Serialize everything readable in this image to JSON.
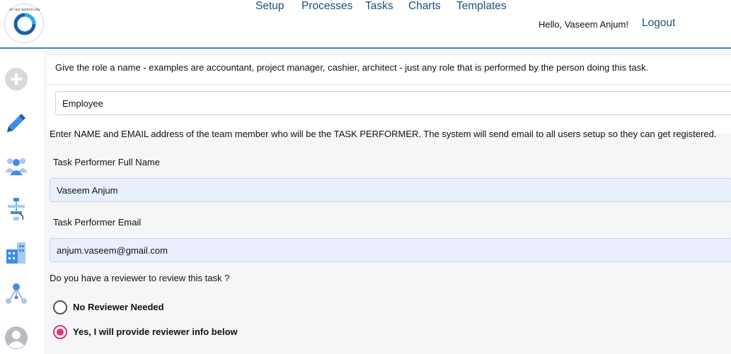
{
  "header": {
    "logo_icon": "my-biz-workflow-logo",
    "logo_text": "MY BIZ WORKFLOW",
    "nav": [
      {
        "label": "Setup"
      },
      {
        "label": "Processes"
      },
      {
        "label": "Tasks"
      },
      {
        "label": "Charts"
      },
      {
        "label": "Templates"
      }
    ],
    "greeting": "Hello,  Vaseem Anjum!",
    "logout": "Logout"
  },
  "sidebar": {
    "items": [
      {
        "icon": "add-icon"
      },
      {
        "icon": "edit-pencil-icon"
      },
      {
        "icon": "team-icon"
      },
      {
        "icon": "flowchart-icon"
      },
      {
        "icon": "buildings-icon"
      },
      {
        "icon": "network-icon"
      },
      {
        "icon": "user-avatar-icon"
      }
    ]
  },
  "form": {
    "role_hint": "Give the role a name - examples are accountant, project manager, cashier, architect - just any role that is performed by the person doing this task.",
    "role_value": "Employee",
    "instruction": "Enter NAME and EMAIL address of the team member who will be the TASK PERFORMER. The system will send email to all users setup so they can get registered.",
    "name_label": "Task Performer Full Name",
    "name_value": "Vaseem Anjum",
    "email_label": "Task Performer Email",
    "email_value": "anjum.vaseem@gmail.com",
    "reviewer_question": "Do you have a reviewer to review this task ?",
    "reviewer_options": [
      {
        "label": "No Reviewer Needed",
        "checked": false
      },
      {
        "label": "Yes, I will provide reviewer info below",
        "checked": true
      }
    ]
  },
  "colors": {
    "nav_link": "#1f4f7a",
    "accent_radio": "#e0357a",
    "autofill_bg": "#e8f0fe",
    "icon_blue": "#3d8ee8"
  }
}
